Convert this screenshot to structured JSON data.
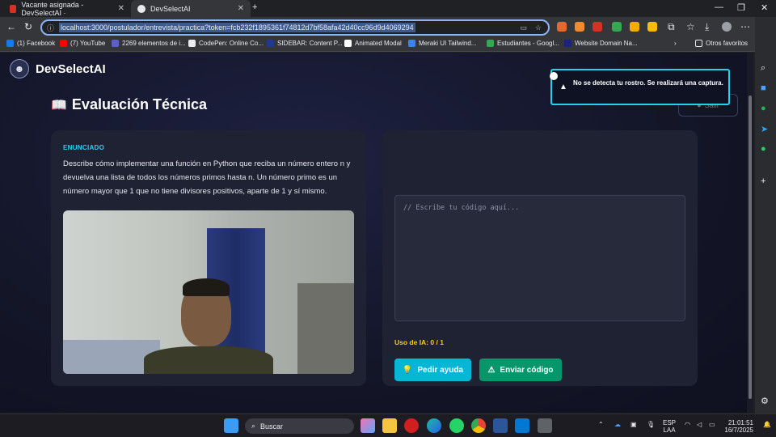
{
  "browser": {
    "tabs": [
      {
        "title": "Vacante asignada - DevSelectAI ·",
        "active": false
      },
      {
        "title": "DevSelectAI",
        "active": true
      }
    ],
    "new_tab": "+",
    "url": "localhost:3000/postulador/entrevista/practica?token=fcb232f1895361f74812d7bf58afa42d40cc96d9d4069294",
    "bookmarks": [
      "(1) Facebook",
      "(7) YouTube",
      "2269 elementos de i...",
      "CodePen: Online Co...",
      "SIDEBAR: Content P...",
      "Animated Modal",
      "Meraki UI Tailwind...",
      "Estudiantes - Googl...",
      "Website Domain Na...",
      "Otros favoritos"
    ]
  },
  "app": {
    "brand": "DevSelectAI",
    "page_title": "Evaluación Técnica",
    "ghost_button": "Salir",
    "enunciado": {
      "label": "ENUNCIADO",
      "text": "Describe cómo implementar una función en Python que reciba un número entero n y devuelva una lista de todos los números primos hasta n. Un número primo es un número mayor que 1 que no tiene divisores positivos, aparte de 1 y sí mismo."
    },
    "editor_placeholder": "// Escribe tu código aquí...",
    "ia_usage": "Uso de IA: 0 / 1",
    "help_button": "Pedir ayuda",
    "send_button": "Enviar código",
    "toast": "No se detecta tu rostro. Se realizará una captura.",
    "colors": {
      "accent_cyan": "#06b6d4",
      "send_green": "#059669",
      "ia_yellow": "#facc15"
    }
  },
  "taskbar": {
    "search": "Buscar",
    "lang": "ESP",
    "lang2": "LAA",
    "time": "21:01:51",
    "date": "16/7/2025"
  }
}
